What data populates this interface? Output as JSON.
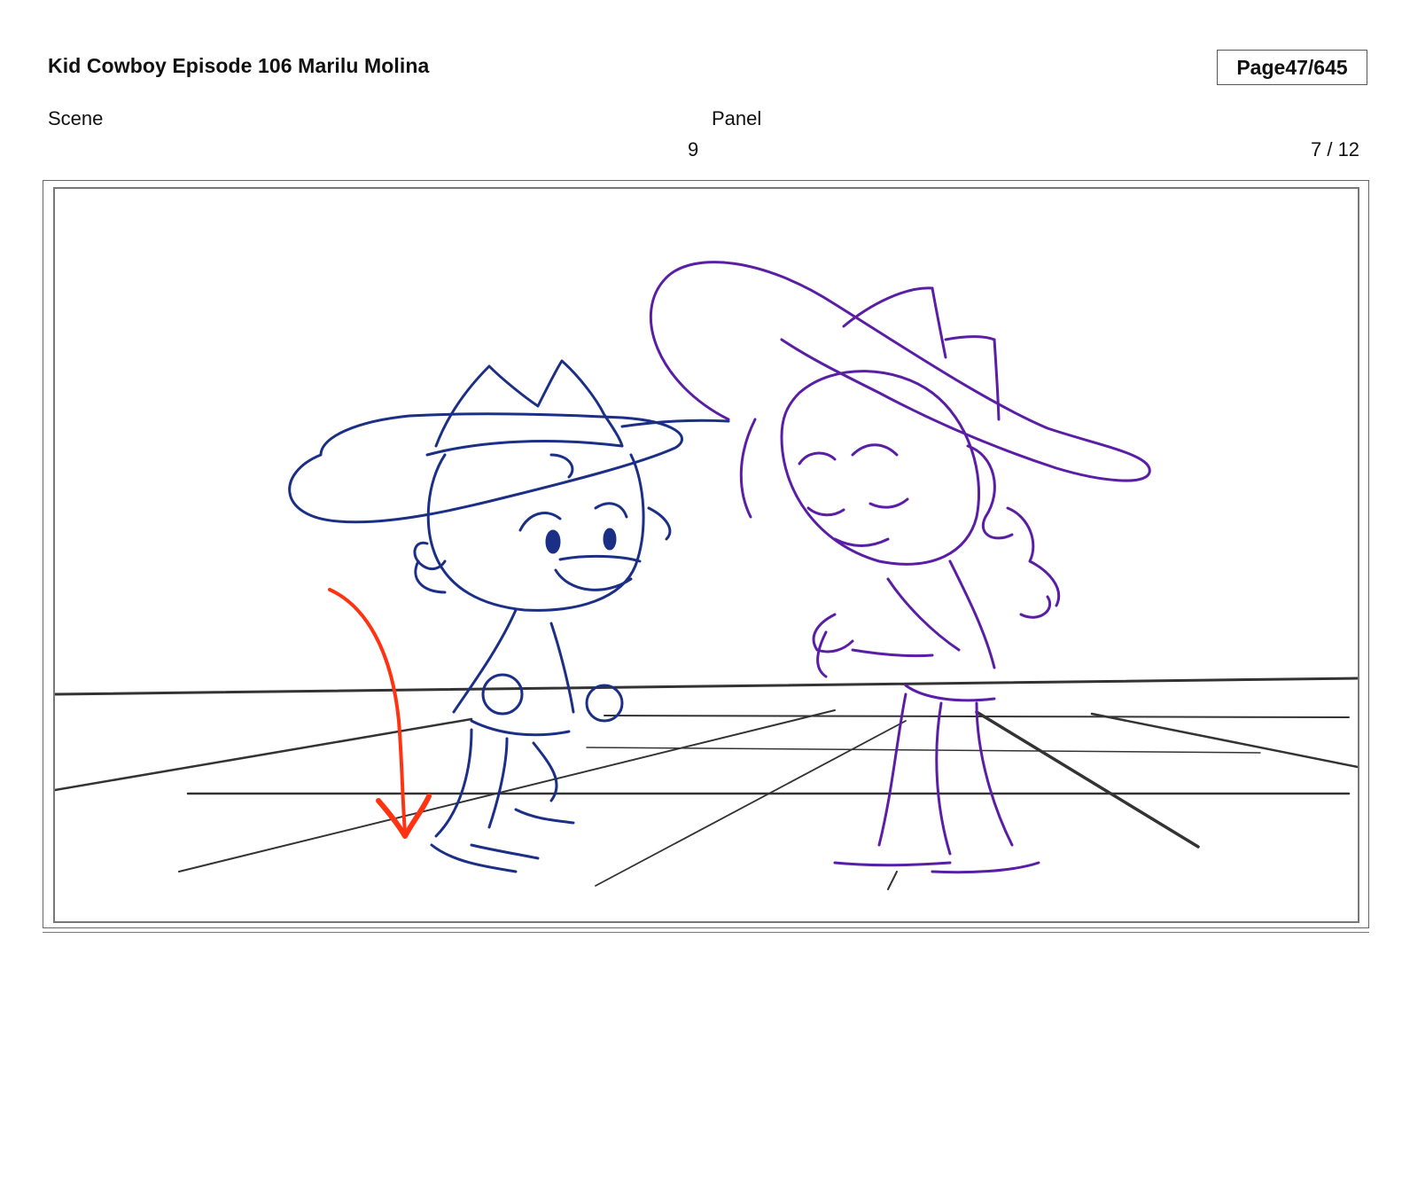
{
  "header": {
    "title": "Kid Cowboy Episode 106 Marilu Molina",
    "page_label": "Page",
    "page_number": "47/645"
  },
  "scene": {
    "label": "Scene",
    "number": "9"
  },
  "panel": {
    "label": "Panel",
    "number": "7 / 12"
  },
  "colors": {
    "kid_cowboy": "#1b2f86",
    "girl": "#5a1ea6",
    "action_arrow": "#ff3311",
    "floor_lines": "#333333"
  },
  "icons": [
    "down-arrow-icon"
  ]
}
